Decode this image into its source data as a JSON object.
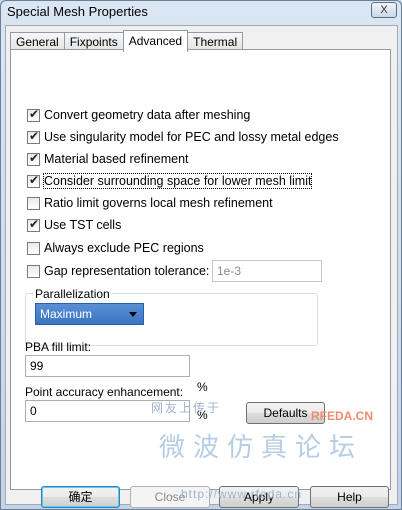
{
  "window": {
    "title": "Special Mesh Properties",
    "close_glyph": "X"
  },
  "tabs": [
    {
      "label": "General",
      "active": false
    },
    {
      "label": "Fixpoints",
      "active": false
    },
    {
      "label": "Advanced",
      "active": true
    },
    {
      "label": "Thermal",
      "active": false
    }
  ],
  "options": [
    {
      "label": "Convert geometry data after meshing",
      "checked": true
    },
    {
      "label": "Use singularity model for PEC and lossy metal edges",
      "checked": true
    },
    {
      "label": "Material based refinement",
      "checked": true
    },
    {
      "label": "Consider surrounding space for lower mesh limit",
      "checked": true
    },
    {
      "label": "Ratio limit governs local mesh refinement",
      "checked": false
    },
    {
      "label": "Use TST cells",
      "checked": true
    },
    {
      "label": "Always exclude PEC regions",
      "checked": false
    },
    {
      "label": "Gap representation tolerance:",
      "checked": false
    }
  ],
  "gap_tolerance": {
    "value": "1e-3"
  },
  "parallelization": {
    "group_label": "Parallelization",
    "selected": "Maximum"
  },
  "pba": {
    "label": "PBA fill limit:",
    "value": "99",
    "unit": "%"
  },
  "point_accuracy": {
    "label": "Point accuracy enhancement:",
    "value": "0",
    "unit": "%"
  },
  "buttons": {
    "defaults": "Defaults",
    "ok": "确定",
    "close": "Close",
    "apply": "Apply",
    "help": "Help"
  },
  "watermark": {
    "top_text": "网友上传于",
    "brand": "RFEDA.CN",
    "main": "微波仿真论坛",
    "url": "http://www.rfeda.cn"
  },
  "colors": {
    "title_bar": "#c3d3e7",
    "selection": "#3b74c2",
    "panel": "#ffffff"
  }
}
